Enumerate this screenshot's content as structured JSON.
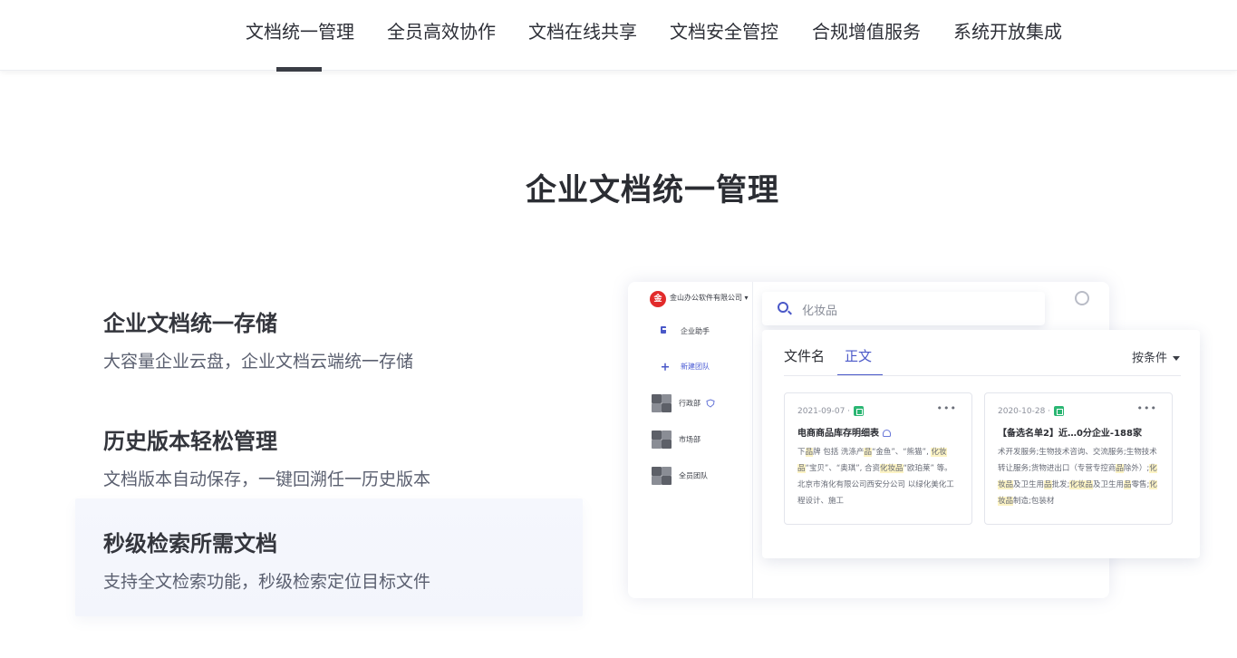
{
  "nav": {
    "tabs": [
      {
        "label": "文档统一管理",
        "active": true
      },
      {
        "label": "全员高效协作",
        "active": false
      },
      {
        "label": "文档在线共享",
        "active": false
      },
      {
        "label": "文档安全管控",
        "active": false
      },
      {
        "label": "合规增值服务",
        "active": false
      },
      {
        "label": "系统开放集成",
        "active": false
      }
    ]
  },
  "hero": {
    "title": "企业文档统一管理"
  },
  "features": [
    {
      "title": "企业文档统一存储",
      "desc": "大容量企业云盘，企业文档云端统一存储",
      "active": false
    },
    {
      "title": "历史版本轻松管理",
      "desc": "文档版本自动保存，一键回溯任一历史版本",
      "active": false
    },
    {
      "title": "秒级检索所需文档",
      "desc": "支持全文检索功能，秒级检索定位目标文件",
      "active": true
    }
  ],
  "app": {
    "company": "金山办公软件有限公司 ▾",
    "logo_text": "金",
    "side_items": [
      {
        "label": "企业助手",
        "icon": "doc-icon"
      },
      {
        "label": "新建团队",
        "icon": "plus-icon"
      },
      {
        "label": "行政部",
        "icon": "team-avatar-icon"
      },
      {
        "label": "市场部",
        "icon": "team-avatar-icon"
      },
      {
        "label": "全员团队",
        "icon": "team-avatar-icon"
      }
    ],
    "search": {
      "value": "化妆品"
    },
    "result_tabs": [
      {
        "label": "文件名",
        "active": false
      },
      {
        "label": "正文",
        "active": true
      }
    ],
    "filter_label": "按条件",
    "results": [
      {
        "date": "2021-09-07 ·",
        "title": "电商商品库存明细表",
        "snippet_parts": [
          {
            "t": "下",
            "h": false
          },
          {
            "t": "品",
            "h": true
          },
          {
            "t": "牌 包括 洗涤产",
            "h": false
          },
          {
            "t": "品",
            "h": true
          },
          {
            "t": "“金鱼”、“熊猫”, ",
            "h": false
          },
          {
            "t": "化妆品",
            "h": true
          },
          {
            "t": "“宝贝”、“奥琪”, 合资",
            "h": false
          },
          {
            "t": "化妆品",
            "h": true
          },
          {
            "t": "“欧珀莱” 等。北京市洧化有限公司西安分公司 以绿化美化工程设计、施工",
            "h": false
          }
        ]
      },
      {
        "date": "2020-10-28 ·",
        "title": "【备选名单2】近…0分企业-188家",
        "snippet_parts": [
          {
            "t": "术开发服务;生物技术咨询、交流服务;生物技术转让服务;货物进出口（专营专控商",
            "h": false
          },
          {
            "t": "品",
            "h": true
          },
          {
            "t": "除外）;",
            "h": false
          },
          {
            "t": "化妆品",
            "h": true
          },
          {
            "t": "及卫生用",
            "h": false
          },
          {
            "t": "品",
            "h": true
          },
          {
            "t": "批发;",
            "h": false
          },
          {
            "t": "化妆品",
            "h": true
          },
          {
            "t": "及卫生用",
            "h": false
          },
          {
            "t": "品",
            "h": true
          },
          {
            "t": "零售;",
            "h": false
          },
          {
            "t": "化妆品",
            "h": true
          },
          {
            "t": "制造;包装材",
            "h": false
          }
        ]
      }
    ]
  }
}
